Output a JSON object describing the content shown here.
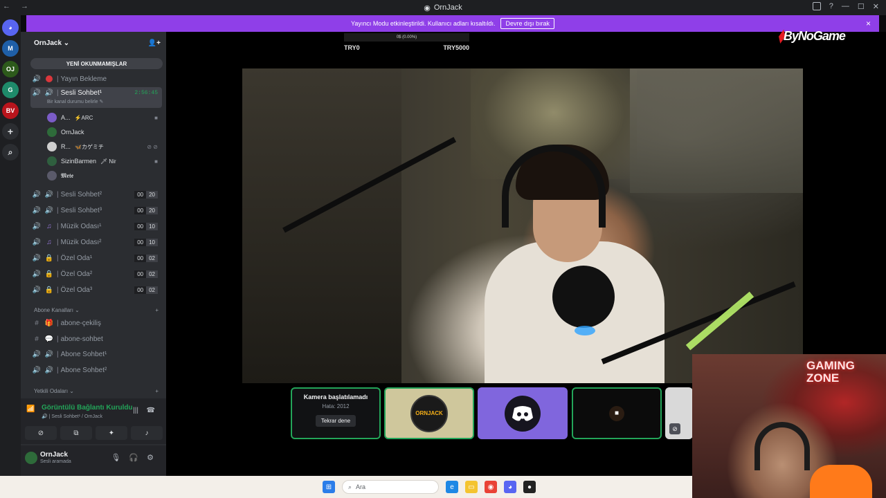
{
  "window": {
    "title": "OrnJack",
    "nav": "← →"
  },
  "banner": {
    "message": "Yayıncı Modu etkinleştirildi. Kullanıcı adları kısaltıldı.",
    "button": "Devre dışı bırak",
    "close": "×"
  },
  "rail": {
    "servers": [
      {
        "label": "M",
        "color": "#1f5fa8"
      },
      {
        "label": "OJ",
        "color": "#2d5a1b"
      },
      {
        "label": "G",
        "color": "#1e8a6a"
      },
      {
        "label": "BV",
        "color": "#b8141c"
      }
    ],
    "add": "+",
    "explore": "⌕"
  },
  "guild": {
    "name": "OrnJack",
    "unread_pill": "YENİ OKUNMAMIŞLAR"
  },
  "channels": {
    "yayin_bekleme": {
      "name": "Yayın Bekleme",
      "sep": "|"
    },
    "sesli1": {
      "name": "Sesli Sohbet¹",
      "sep": "|",
      "timer": "2:56:45",
      "status": "Bir kanal durumu belirle ✎"
    },
    "users": [
      {
        "name": "A...",
        "tag": "⚡ARC",
        "color": "#7b5cc7"
      },
      {
        "name": "OrnJack",
        "tag": "",
        "color": "#2e6b3a"
      },
      {
        "name": "R...",
        "tag": "🦋カゲミチ",
        "color": "#cfcfcf"
      },
      {
        "name": "SizinBarmen",
        "tag": "🗡 Nir",
        "color": "#2f5f3f"
      },
      {
        "name": "𝕸𝖊𝖙𝖊",
        "tag": "",
        "color": "#5a5a6a"
      }
    ],
    "voice": [
      {
        "name": "Sesli Sohbet²",
        "sep": "|",
        "a": "00",
        "b": "20"
      },
      {
        "name": "Sesli Sohbet³",
        "sep": "|",
        "a": "00",
        "b": "20"
      },
      {
        "name": "Müzik Odası¹",
        "sep": "|",
        "a": "00",
        "b": "10"
      },
      {
        "name": "Müzik Odası²",
        "sep": "|",
        "a": "00",
        "b": "10"
      },
      {
        "name": "Özel Oda¹",
        "sep": "|",
        "a": "00",
        "b": "02"
      },
      {
        "name": "Özel Oda²",
        "sep": "|",
        "a": "00",
        "b": "02"
      },
      {
        "name": "Özel Oda³",
        "sep": "|",
        "a": "00",
        "b": "02"
      }
    ],
    "category_abone": "Abone Kanalları ⌄",
    "abone": [
      {
        "name": "abone-çekiliş",
        "sep": "|"
      },
      {
        "name": "abone-sohbet",
        "sep": "|"
      },
      {
        "name": "Abone Sohbet¹",
        "sep": "|"
      },
      {
        "name": "Abone Sohbet²",
        "sep": "|"
      }
    ],
    "category_yetkili": "Yetkili Odaları ⌄"
  },
  "voice_panel": {
    "status": "Görüntülü Bağlantı Kuruldu",
    "channel": "🔊 | Sesli Sohbet¹ / OrnJack"
  },
  "user_panel": {
    "name": "OrnJack",
    "status": "Sesli aramada"
  },
  "donation": {
    "progress_text": "0$ (0.00%)",
    "min": "TRY0",
    "max": "TRY5000"
  },
  "brand": {
    "logo": "ByNoGame"
  },
  "tiles": {
    "error_title": "Kamera başlatılamadı",
    "error_code": "Hata: 2012",
    "retry": "Tekrar dene",
    "ornjack_logo": "ORNJACK"
  },
  "webcam": {
    "overlay": "GAMING ZONE"
  },
  "taskbar": {
    "search_placeholder": "Ara"
  },
  "colors": {
    "accent": "#8f3fe8",
    "online": "#23a559",
    "sidebar": "#2b2d31"
  }
}
